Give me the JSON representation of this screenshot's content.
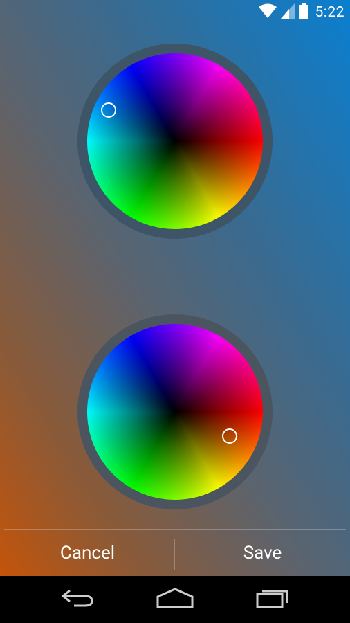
{
  "status_bar": {
    "time": "5:22",
    "icons": [
      "wifi-icon",
      "signal-icon",
      "battery-icon"
    ]
  },
  "color_pickers": [
    {
      "name": "top-color-wheel"
    },
    {
      "name": "bottom-color-wheel"
    }
  ],
  "actions": {
    "cancel_label": "Cancel",
    "save_label": "Save"
  },
  "nav_bar": {
    "buttons": [
      "back-icon",
      "home-icon",
      "recents-icon"
    ]
  },
  "colors": {
    "background_top": "#0a7fd0",
    "background_bottom": "#c4540a",
    "wheel_ring_top": "#3d5566",
    "wheel_ring_bottom": "#4b5560",
    "nav_bar": "#000000"
  }
}
